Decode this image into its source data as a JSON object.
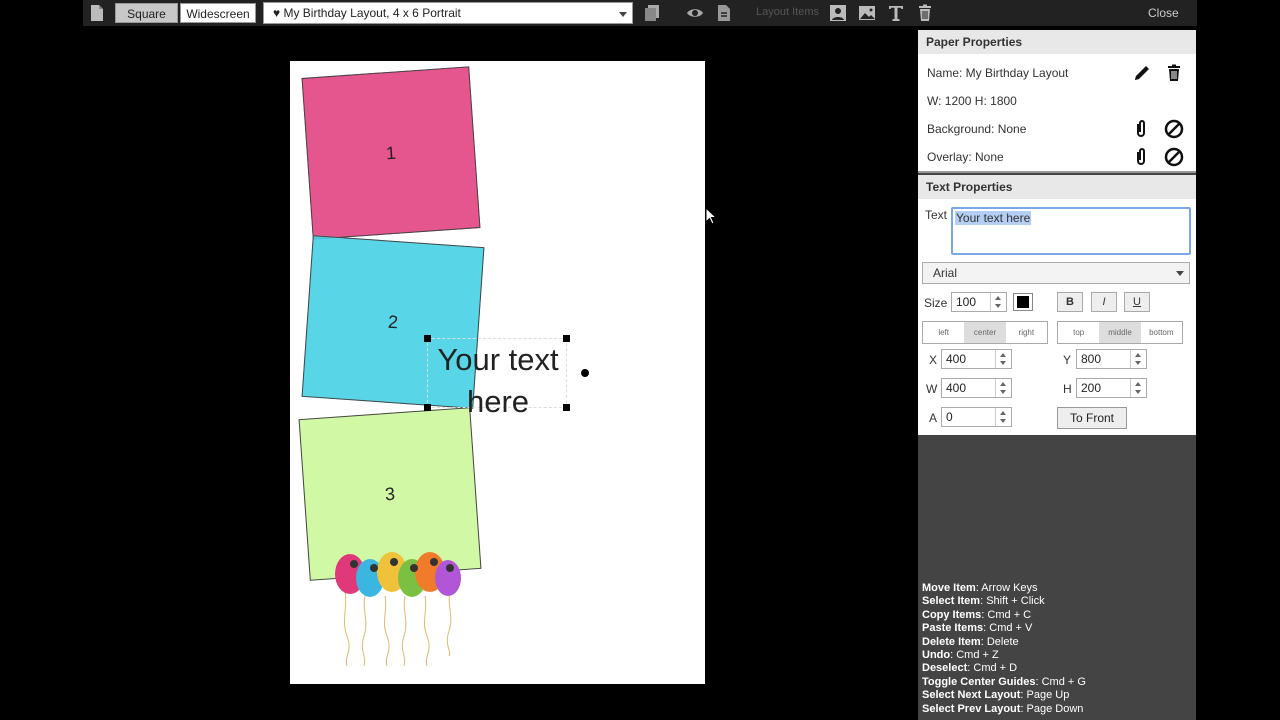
{
  "toolbar": {
    "square_label": "Square",
    "widescreen_label": "Widescreen",
    "layout_selected": "♥ My Birthday Layout, 4 x 6 Portrait",
    "layout_items_label": "Layout Items",
    "close_label": "Close",
    "icons": [
      "new-page-icon",
      "copy-icon",
      "preview-eye-icon",
      "export-icon",
      "add-person-icon",
      "add-image-icon",
      "add-text-icon",
      "trash-icon"
    ]
  },
  "paper": {
    "boxes": [
      {
        "label": "1",
        "color": "#e5568f"
      },
      {
        "label": "2",
        "color": "#46d2e6"
      },
      {
        "label": "3",
        "color": "#cdf8a0"
      }
    ],
    "text_item": {
      "line1": "Your text",
      "line2": "here"
    }
  },
  "paper_properties": {
    "title": "Paper Properties",
    "name": "Name: My Birthday Layout",
    "size": "W: 1200 H: 1800",
    "background": "Background: None",
    "overlay": "Overlay: None"
  },
  "text_properties": {
    "title": "Text Properties",
    "text_label": "Text",
    "text_value": "Your text here",
    "font": "Arial",
    "size_label": "Size",
    "size_value": "100",
    "bold": "B",
    "italic": "I",
    "underline": "U",
    "halign": [
      "left",
      "center",
      "right"
    ],
    "halign_active": "center",
    "valign": [
      "top",
      "middle",
      "bottom"
    ],
    "valign_active": "middle",
    "x_label": "X",
    "x_value": "400",
    "y_label": "Y",
    "y_value": "800",
    "w_label": "W",
    "w_value": "400",
    "h_label": "H",
    "h_value": "200",
    "a_label": "A",
    "a_value": "0",
    "to_front": "To Front"
  },
  "shortcuts": [
    {
      "action": "Move Item",
      "keys": ": Arrow Keys"
    },
    {
      "action": "Select Item",
      "keys": ": Shift + Click"
    },
    {
      "action": "Copy Items",
      "keys": ": Cmd + C"
    },
    {
      "action": "Paste Items",
      "keys": ": Cmd + V"
    },
    {
      "action": "Delete Item",
      "keys": ": Delete"
    },
    {
      "action": "Undo",
      "keys": ": Cmd + Z"
    },
    {
      "action": "Deselect",
      "keys": ": Cmd + D"
    },
    {
      "action": "Toggle Center Guides",
      "keys": ": Cmd + G"
    },
    {
      "action": "Select Next Layout",
      "keys": ": Page Up"
    },
    {
      "action": "Select Prev Layout",
      "keys": ": Page Down"
    }
  ]
}
